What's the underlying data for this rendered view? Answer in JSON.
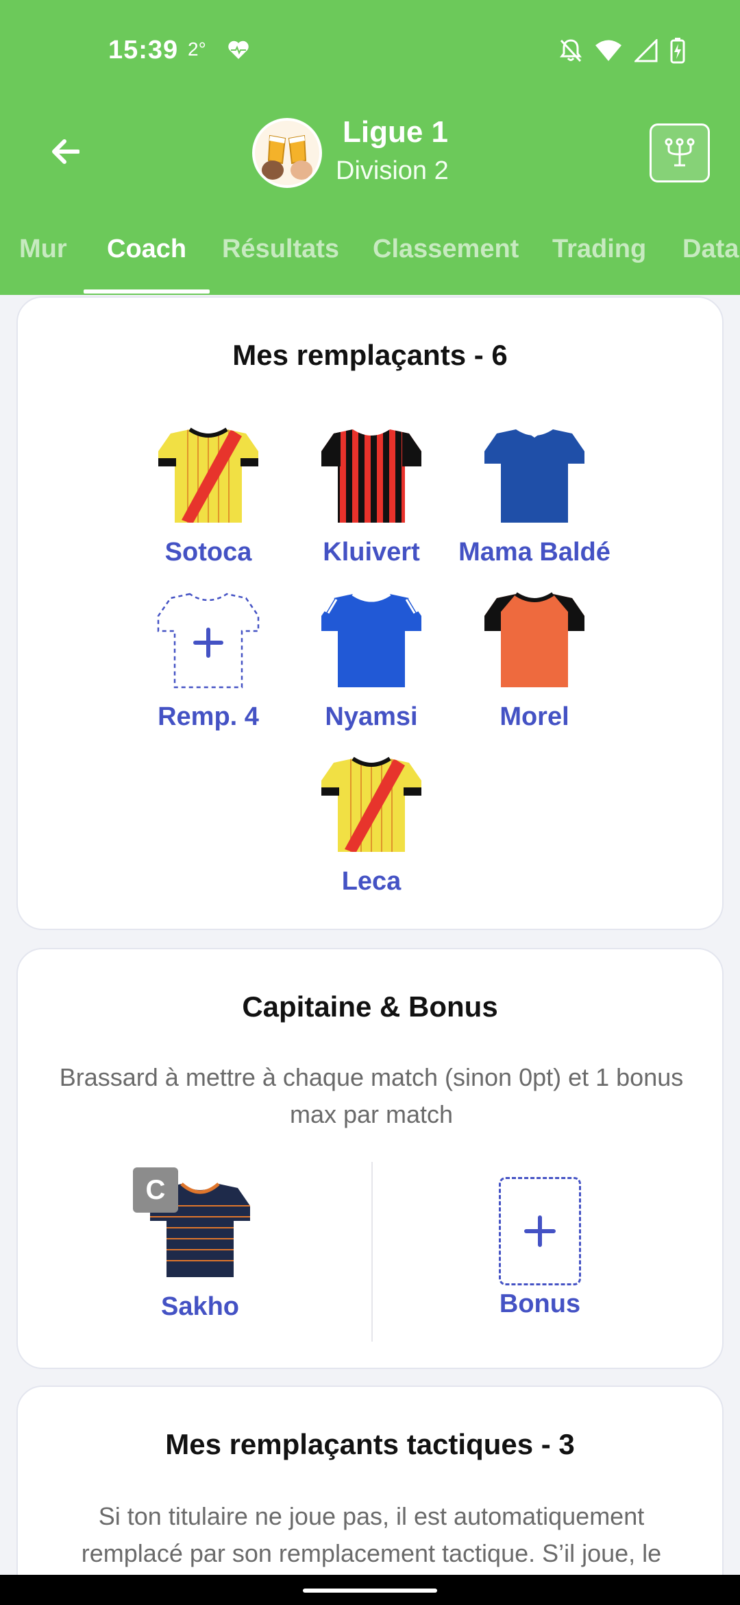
{
  "status_bar": {
    "time": "15:39",
    "temperature": "2°"
  },
  "header": {
    "league_title": "Ligue 1",
    "league_subtitle": "Division 2",
    "accent_color": "#6cc95a"
  },
  "tabs": [
    {
      "label": "Mur",
      "active": false
    },
    {
      "label": "Coach",
      "active": true
    },
    {
      "label": "Résultats",
      "active": false
    },
    {
      "label": "Classement",
      "active": false
    },
    {
      "label": "Trading",
      "active": false
    },
    {
      "label": "Data",
      "active": false
    }
  ],
  "substitutes": {
    "title": "Mes remplaçants - 6",
    "players": [
      {
        "name": "Sotoca",
        "kit": "yellow-red-sash"
      },
      {
        "name": "Kluivert",
        "kit": "red-black-stripes"
      },
      {
        "name": "Mama Baldé",
        "kit": "dark-blue"
      },
      {
        "name": "Remp. 4",
        "kit": "empty-slot"
      },
      {
        "name": "Nyamsi",
        "kit": "blue"
      },
      {
        "name": "Morel",
        "kit": "orange-black"
      },
      {
        "name": "Leca",
        "kit": "yellow-red-sash"
      }
    ]
  },
  "captain_bonus": {
    "title": "Capitaine & Bonus",
    "description": "Brassard à mettre à chaque match (sinon 0pt) et 1 bonus max par match",
    "captain_badge": "C",
    "captain_name": "Sakho",
    "captain_kit": "navy-orange-stripes",
    "bonus_label": "Bonus"
  },
  "tactical": {
    "title": "Mes remplaçants tactiques - 3",
    "description": "Si ton titulaire ne joue pas, il est automatiquement remplacé par son remplacement tactique. S’il joue, le"
  },
  "colors": {
    "player_name": "#4452c4",
    "header_green": "#6cc95a"
  }
}
